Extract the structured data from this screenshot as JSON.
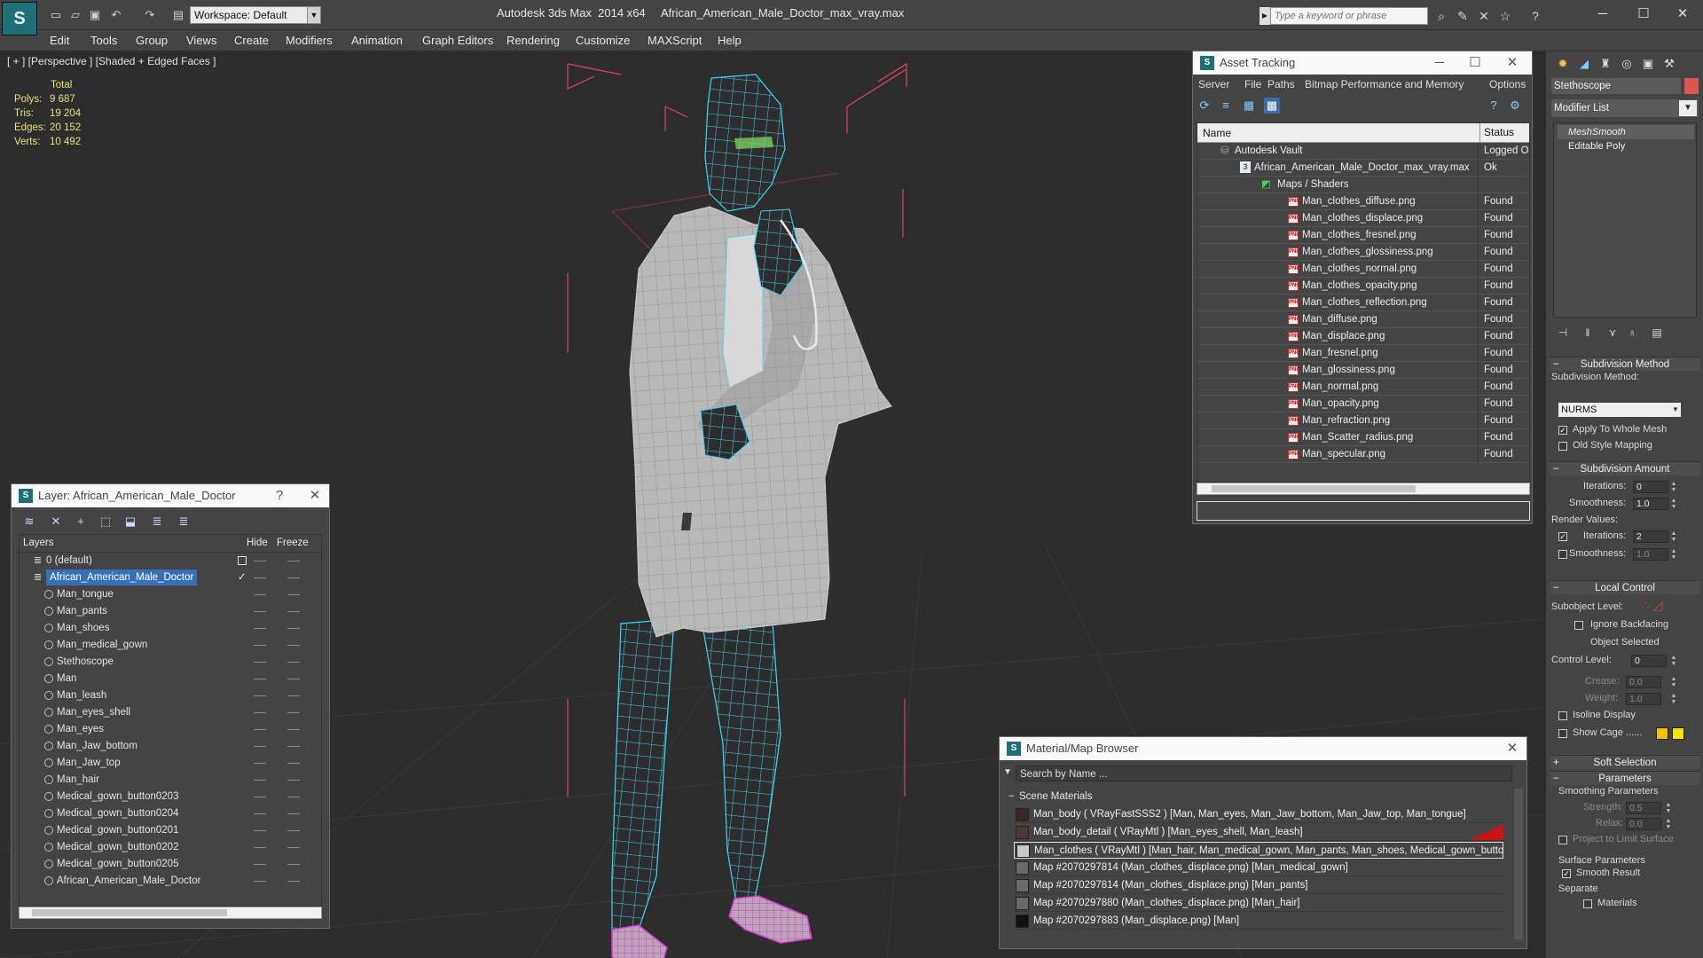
{
  "app": {
    "title": "Autodesk 3ds Max  2014 x64     African_American_Male_Doctor_max_vray.max",
    "workspace": "Workspace: Default",
    "search_placeholder": "Type a keyword or phrase"
  },
  "menu": [
    "Edit",
    "Tools",
    "Group",
    "Views",
    "Create",
    "Modifiers",
    "Animation",
    "Graph Editors",
    "Rendering",
    "Customize",
    "MAXScript",
    "Help"
  ],
  "viewport": {
    "label": "[ + ] [Perspective ] [Shaded + Edged Faces ]",
    "stats_header": "Total",
    "stats": [
      {
        "label": "Polys:",
        "value": "9 687"
      },
      {
        "label": "Tris:",
        "value": "19 204"
      },
      {
        "label": "Edges:",
        "value": "20 152"
      },
      {
        "label": "Verts:",
        "value": "10 492"
      }
    ]
  },
  "asset_tracking": {
    "title": "Asset Tracking",
    "menu": [
      "Server",
      "File",
      "Paths",
      "Bitmap Performance and Memory",
      "Options"
    ],
    "col_name": "Name",
    "col_status": "Status",
    "rows": [
      {
        "name": "Autodesk Vault",
        "status": "Logged Ou",
        "level": 0,
        "kind": "vault"
      },
      {
        "name": "African_American_Male_Doctor_max_vray.max",
        "status": "Ok",
        "level": 1,
        "kind": "max"
      },
      {
        "name": "Maps / Shaders",
        "status": "",
        "level": 2,
        "kind": "folder"
      },
      {
        "name": "Man_clothes_diffuse.png",
        "status": "Found",
        "level": 3,
        "kind": "png"
      },
      {
        "name": "Man_clothes_displace.png",
        "status": "Found",
        "level": 3,
        "kind": "png"
      },
      {
        "name": "Man_clothes_fresnel.png",
        "status": "Found",
        "level": 3,
        "kind": "png"
      },
      {
        "name": "Man_clothes_glossiness.png",
        "status": "Found",
        "level": 3,
        "kind": "png"
      },
      {
        "name": "Man_clothes_normal.png",
        "status": "Found",
        "level": 3,
        "kind": "png"
      },
      {
        "name": "Man_clothes_opacity.png",
        "status": "Found",
        "level": 3,
        "kind": "png"
      },
      {
        "name": "Man_clothes_reflection.png",
        "status": "Found",
        "level": 3,
        "kind": "png"
      },
      {
        "name": "Man_diffuse.png",
        "status": "Found",
        "level": 3,
        "kind": "png"
      },
      {
        "name": "Man_displace.png",
        "status": "Found",
        "level": 3,
        "kind": "png"
      },
      {
        "name": "Man_fresnel.png",
        "status": "Found",
        "level": 3,
        "kind": "png"
      },
      {
        "name": "Man_glossiness.png",
        "status": "Found",
        "level": 3,
        "kind": "png"
      },
      {
        "name": "Man_normal.png",
        "status": "Found",
        "level": 3,
        "kind": "png"
      },
      {
        "name": "Man_opacity.png",
        "status": "Found",
        "level": 3,
        "kind": "png"
      },
      {
        "name": "Man_refraction.png",
        "status": "Found",
        "level": 3,
        "kind": "png"
      },
      {
        "name": "Man_Scatter_radius.png",
        "status": "Found",
        "level": 3,
        "kind": "png"
      },
      {
        "name": "Man_specular.png",
        "status": "Found",
        "level": 3,
        "kind": "png"
      }
    ]
  },
  "layer_window": {
    "title": "Layer: African_American_Male_Doctor",
    "help": "?",
    "col_layers": "Layers",
    "col_hide": "Hide",
    "col_freeze": "Freeze",
    "rows": [
      {
        "name": "0 (default)",
        "level": 0,
        "kind": "layer"
      },
      {
        "name": "African_American_Male_Doctor",
        "level": 0,
        "kind": "layer",
        "selected": true
      },
      {
        "name": "Man_tongue",
        "level": 1,
        "kind": "object"
      },
      {
        "name": "Man_pants",
        "level": 1,
        "kind": "object"
      },
      {
        "name": "Man_shoes",
        "level": 1,
        "kind": "object"
      },
      {
        "name": "Man_medical_gown",
        "level": 1,
        "kind": "object"
      },
      {
        "name": "Stethoscope",
        "level": 1,
        "kind": "object"
      },
      {
        "name": "Man",
        "level": 1,
        "kind": "object"
      },
      {
        "name": "Man_leash",
        "level": 1,
        "kind": "object"
      },
      {
        "name": "Man_eyes_shell",
        "level": 1,
        "kind": "object"
      },
      {
        "name": "Man_eyes",
        "level": 1,
        "kind": "object"
      },
      {
        "name": "Man_Jaw_bottom",
        "level": 1,
        "kind": "object"
      },
      {
        "name": "Man_Jaw_top",
        "level": 1,
        "kind": "object"
      },
      {
        "name": "Man_hair",
        "level": 1,
        "kind": "object"
      },
      {
        "name": "Medical_gown_button0203",
        "level": 1,
        "kind": "object"
      },
      {
        "name": "Medical_gown_button0204",
        "level": 1,
        "kind": "object"
      },
      {
        "name": "Medical_gown_button0201",
        "level": 1,
        "kind": "object"
      },
      {
        "name": "Medical_gown_button0202",
        "level": 1,
        "kind": "object"
      },
      {
        "name": "Medical_gown_button0205",
        "level": 1,
        "kind": "object"
      },
      {
        "name": "African_American_Male_Doctor",
        "level": 1,
        "kind": "object"
      }
    ]
  },
  "material_browser": {
    "title": "Material/Map Browser",
    "search_placeholder": "Search by Name ...",
    "group": "Scene Materials",
    "rows": [
      {
        "text": "Man_body  ( VRayFastSSS2 ) [Man, Man_eyes, Man_Jaw_bottom, Man_Jaw_top, Man_tongue]",
        "swatch": "#3a2a26"
      },
      {
        "text": "Man_body_detail  ( VRayMtl ) [Man_eyes_shell, Man_leash]",
        "swatch": "#4a3a36",
        "accent": "#cc1111"
      },
      {
        "text": "Man_clothes  ( VRayMtl ) [Man_hair, Man_medical_gown, Man_pants, Man_shoes, Medical_gown_butto...",
        "swatch": "#c8c8c8",
        "selected": true
      },
      {
        "text": "Map #2070297814 (Man_clothes_displace.png) [Man_medical_gown]",
        "swatch": "#6a6a6a"
      },
      {
        "text": "Map #2070297814 (Man_clothes_displace.png) [Man_pants]",
        "swatch": "#6a6a6a"
      },
      {
        "text": "Map #2070297880 (Man_clothes_displace.png) [Man_hair]",
        "swatch": "#6a6a6a"
      },
      {
        "text": "Map #2070297883 (Man_displace.png) [Man]",
        "swatch": "#111111"
      }
    ]
  },
  "command_panel": {
    "object_name": "Stethoscope",
    "object_color": "#d8574e",
    "modifier_list": "Modifier List",
    "stack": [
      "MeshSmooth",
      "Editable Poly"
    ],
    "subdivision_method": {
      "rollout": "Subdivision Method",
      "label": "Subdivision Method:",
      "value": "NURMS",
      "apply_whole_mesh": "Apply To Whole Mesh",
      "old_style": "Old Style Mapping"
    },
    "subdivision_amount": {
      "rollout": "Subdivision Amount",
      "iterations_label": "Iterations:",
      "iterations": "0",
      "smoothness_label": "Smoothness:",
      "smoothness": "1.0",
      "render_values": "Render Values:",
      "r_iterations": "2",
      "r_smoothness": "1.0"
    },
    "local_control": {
      "rollout": "Local Control",
      "subobject": "Subobject Level:",
      "ignore_backfacing": "Ignore Backfacing",
      "object_selected": "Object Selected",
      "control_level_label": "Control Level:",
      "control_level": "0",
      "crease_label": "Crease:",
      "crease": "0.0",
      "weight_label": "Weight:",
      "weight": "1.0",
      "isoline": "Isoline Display",
      "show_cage": "Show Cage ......",
      "cage_color_1": "#f2c200",
      "cage_color_2": "#f2e600"
    },
    "soft_selection": "Soft Selection",
    "parameters": {
      "rollout": "Parameters",
      "smoothing": "Smoothing Parameters",
      "strength_label": "Strength:",
      "strength": "0.5",
      "relax_label": "Relax:",
      "relax": "0.0",
      "project": "Project to Limit Surface",
      "surface": "Surface Parameters",
      "smooth_result": "Smooth Result",
      "separate": "Separate",
      "materials": "Materials"
    }
  },
  "colors": {
    "wire_cyan": "#3fd3f0",
    "wire_magenta": "#d23ad2",
    "gizmo_red": "#e0426a",
    "selection_blue": "#3870b8"
  }
}
